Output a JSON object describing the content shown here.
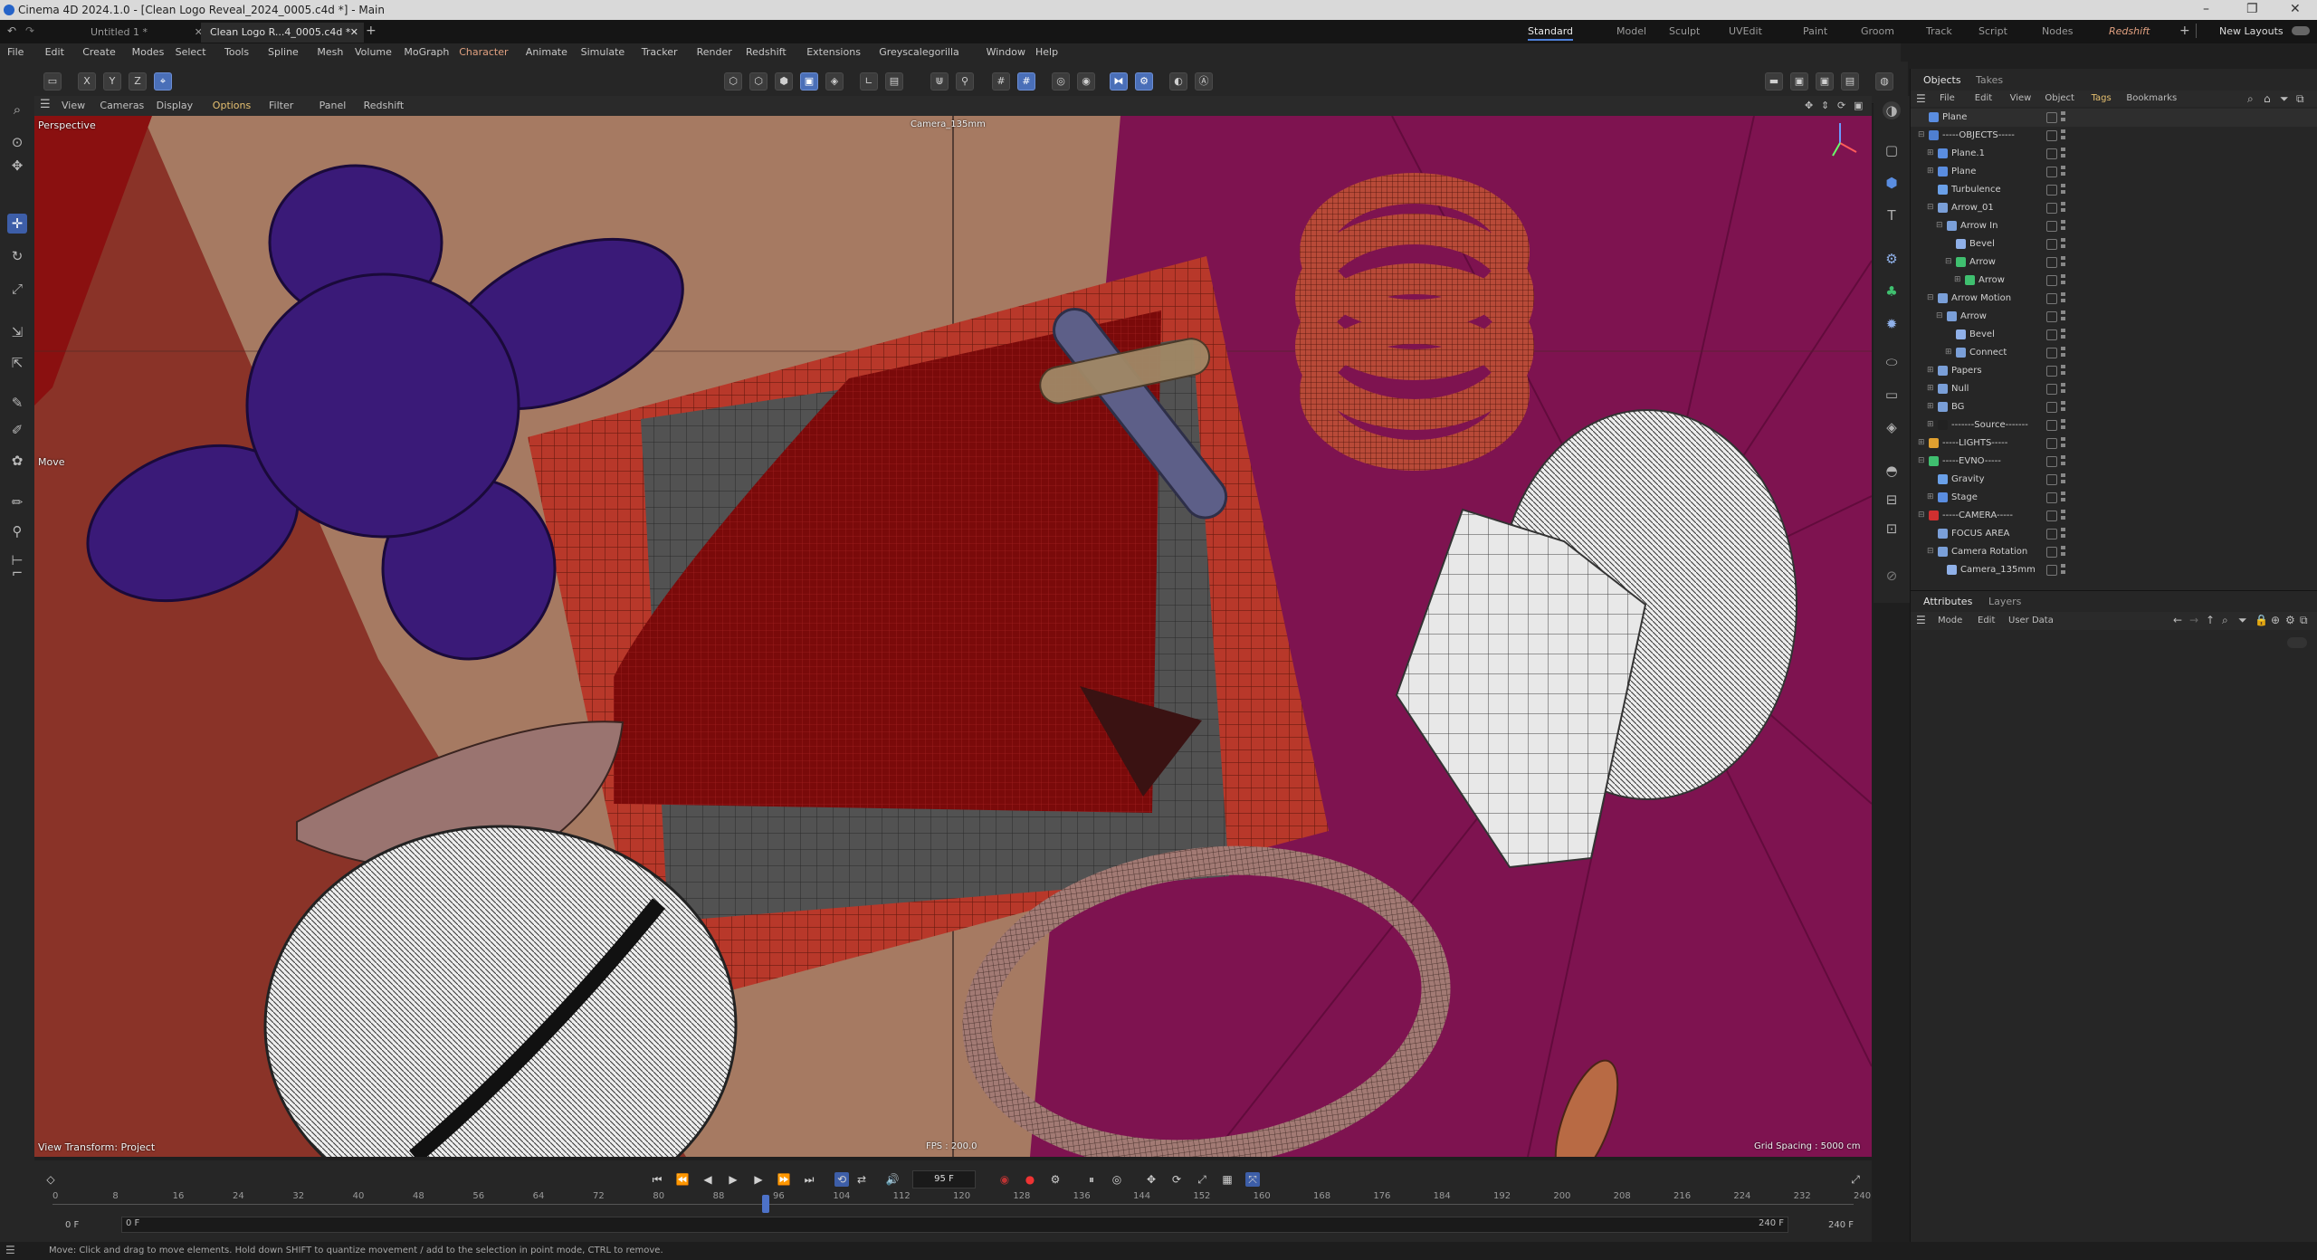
{
  "window": {
    "title": "Cinema 4D 2024.1.0 - [Clean Logo Reveal_2024_0005.c4d *] - Main"
  },
  "doc_tabs": [
    {
      "label": "Untitled 1 *",
      "active": false
    },
    {
      "label": "Clean Logo R...4_0005.c4d *",
      "active": true
    }
  ],
  "layouts": [
    "Standard",
    "Model",
    "Sculpt",
    "UVEdit",
    "Paint",
    "Groom",
    "Track",
    "Script",
    "Nodes",
    "Redshift"
  ],
  "layout_active": "Standard",
  "new_layouts_label": "New Layouts",
  "menu": [
    "File",
    "Edit",
    "Create",
    "Modes",
    "Select",
    "Tools",
    "Spline",
    "Mesh",
    "Volume",
    "MoGraph",
    "Character",
    "Animate",
    "Simulate",
    "Tracker",
    "Render",
    "Redshift",
    "Extensions",
    "Greyscalegorilla",
    "Window",
    "Help"
  ],
  "axis_buttons": [
    "X",
    "Y",
    "Z"
  ],
  "viewport_menu": [
    "View",
    "Cameras",
    "Display",
    "Options",
    "Filter",
    "Panel",
    "Redshift"
  ],
  "viewport": {
    "projection": "Perspective",
    "camera": "Camera_135mm",
    "tool_hud": "Move",
    "view_transform": "View Transform: Project",
    "fps": "FPS : 200.0",
    "grid_spacing": "Grid Spacing : 5000 cm"
  },
  "timeline": {
    "current_frame": "95 F",
    "start": "0 F",
    "start2": "0 F",
    "end": "240 F",
    "end2": "240 F",
    "ticks": [
      "0",
      "8",
      "16",
      "24",
      "32",
      "40",
      "48",
      "56",
      "64",
      "72",
      "80",
      "88",
      "96",
      "104",
      "112",
      "120",
      "128",
      "136",
      "144",
      "152",
      "160",
      "168",
      "176",
      "184",
      "192",
      "200",
      "208",
      "216",
      "224",
      "232",
      "240"
    ],
    "playhead": 95,
    "max": 240
  },
  "status": "Move: Click and drag to move elements. Hold down SHIFT to quantize movement / add to the selection in point mode, CTRL to remove.",
  "objects_panel": {
    "tabs": [
      "Objects",
      "Takes"
    ],
    "menu": [
      "File",
      "Edit",
      "View",
      "Object",
      "Tags",
      "Bookmarks"
    ],
    "rows": [
      {
        "name": "Plane",
        "indent": 0,
        "icon": "#5a8de0",
        "exp": ""
      },
      {
        "name": "-----OBJECTS-----",
        "indent": 0,
        "icon": "#4f7fd0",
        "exp": "⊟"
      },
      {
        "name": "Plane.1",
        "indent": 1,
        "icon": "#5a8de0",
        "exp": "⊞"
      },
      {
        "name": "Plane",
        "indent": 1,
        "icon": "#5a8de0",
        "exp": "⊞"
      },
      {
        "name": "Turbulence",
        "indent": 1,
        "icon": "#6aa0e8",
        "exp": ""
      },
      {
        "name": "Arrow_01",
        "indent": 1,
        "icon": "#7a9fd8",
        "exp": "⊟"
      },
      {
        "name": "Arrow In",
        "indent": 2,
        "icon": "#7a9fd8",
        "exp": "⊟"
      },
      {
        "name": "Bevel",
        "indent": 3,
        "icon": "#8fb0e8",
        "exp": ""
      },
      {
        "name": "Arrow",
        "indent": 3,
        "icon": "#3fbf6f",
        "exp": "⊟"
      },
      {
        "name": "Arrow",
        "indent": 4,
        "icon": "#3fbf6f",
        "exp": "⊞"
      },
      {
        "name": "Arrow Motion",
        "indent": 1,
        "icon": "#7a9fd8",
        "exp": "⊟"
      },
      {
        "name": "Arrow",
        "indent": 2,
        "icon": "#7a9fd8",
        "exp": "⊟"
      },
      {
        "name": "Bevel",
        "indent": 3,
        "icon": "#8fb0e8",
        "exp": ""
      },
      {
        "name": "Connect",
        "indent": 3,
        "icon": "#7a9fd8",
        "exp": "⊞"
      },
      {
        "name": "Papers",
        "indent": 1,
        "icon": "#7a9fd8",
        "exp": "⊞"
      },
      {
        "name": "Null",
        "indent": 1,
        "icon": "#7a9fd8",
        "exp": "⊞"
      },
      {
        "name": "BG",
        "indent": 1,
        "icon": "#7a9fd8",
        "exp": "⊞"
      },
      {
        "name": "-------Source-------",
        "indent": 1,
        "icon": "#222222",
        "exp": "⊞"
      },
      {
        "name": "-----LIGHTS-----",
        "indent": 0,
        "icon": "#e0a030",
        "exp": "⊞"
      },
      {
        "name": "-----EVNO-----",
        "indent": 0,
        "icon": "#3fbf6f",
        "exp": "⊟"
      },
      {
        "name": "Gravity",
        "indent": 1,
        "icon": "#6aa0e8",
        "exp": ""
      },
      {
        "name": "Stage",
        "indent": 1,
        "icon": "#5a8de0",
        "exp": "⊞"
      },
      {
        "name": "-----CAMERA-----",
        "indent": 0,
        "icon": "#d03030",
        "exp": "⊟"
      },
      {
        "name": "FOCUS AREA",
        "indent": 1,
        "icon": "#7a9fd8",
        "exp": ""
      },
      {
        "name": "Camera Rotation",
        "indent": 1,
        "icon": "#7a9fd8",
        "exp": "⊟"
      },
      {
        "name": "Camera_135mm",
        "indent": 2,
        "icon": "#8fb0e8",
        "exp": ""
      }
    ]
  },
  "attributes_panel": {
    "tabs": [
      "Attributes",
      "Layers"
    ],
    "menu": [
      "Mode",
      "Edit",
      "User Data"
    ]
  }
}
